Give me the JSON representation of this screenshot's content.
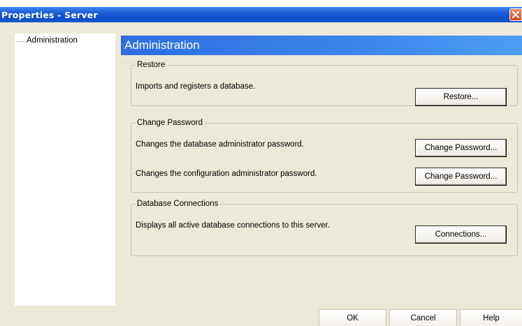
{
  "window": {
    "title": "Properties - Server"
  },
  "tree": {
    "items": [
      {
        "label": "Administration"
      }
    ]
  },
  "header": {
    "title": "Administration"
  },
  "sections": {
    "restore": {
      "legend": "Restore",
      "rows": [
        {
          "description": "Imports and registers a database.",
          "button": "Restore..."
        }
      ]
    },
    "change_password": {
      "legend": "Change Password",
      "rows": [
        {
          "description": "Changes the database administrator password.",
          "button": "Change Password..."
        },
        {
          "description": "Changes the configuration administrator password.",
          "button": "Change Password..."
        }
      ]
    },
    "database_connections": {
      "legend": "Database Connections",
      "rows": [
        {
          "description": "Displays all active database connections to this server.",
          "button": "Connections..."
        }
      ]
    }
  },
  "footer": {
    "ok": "OK",
    "cancel": "Cancel",
    "help": "Help"
  },
  "icons": {
    "close": "close-icon"
  },
  "colors": {
    "titlebar": "#0b4ec8",
    "header": "#3a86ec",
    "close": "#d9441c",
    "dialog_bg": "#ece9d8"
  }
}
